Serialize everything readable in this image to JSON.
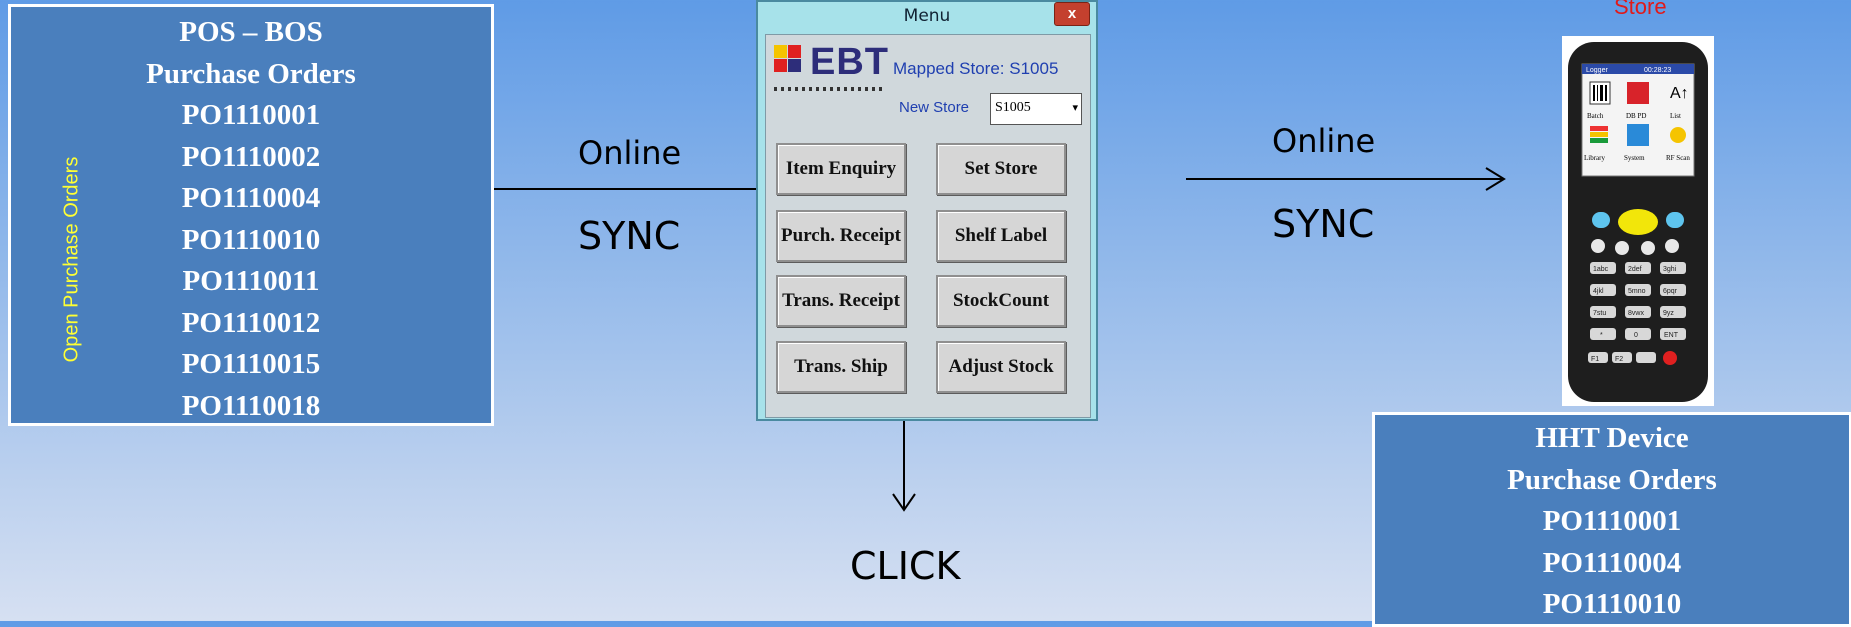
{
  "pos_box": {
    "lines": [
      "POS – BOS",
      "Purchase Orders",
      "PO1110001",
      "PO1110002",
      "PO1110004",
      "PO1110010",
      "PO1110011",
      "PO1110012",
      "PO1110015",
      "PO1110018"
    ]
  },
  "side_label": "Open Purchase Orders",
  "left_flow": {
    "online": "Online",
    "sync": "SYNC"
  },
  "right_flow": {
    "online": "Online",
    "sync": "SYNC"
  },
  "click_label": "CLICK",
  "menu": {
    "title": "Menu",
    "close": "x",
    "logo_text": "EBT",
    "mapped_store": "Mapped Store: S1005",
    "new_store_label": "New Store",
    "store_value": "S1005",
    "buttons": [
      "Item Enquiry",
      "Set Store",
      "Purch. Receipt",
      "Shelf Label",
      "Trans. Receipt",
      "StockCount",
      "Trans. Ship",
      "Adjust Stock"
    ]
  },
  "store_label": "Store",
  "hht_box": {
    "lines": [
      "HHT Device",
      "Purchase Orders",
      "PO1110001",
      "PO1110004",
      "PO1110010"
    ]
  },
  "device_screen": {
    "header": "Logger",
    "time": "00:28:23",
    "apps": [
      "Batch",
      "DB PD",
      "List",
      "Library",
      "System",
      "RF Scan"
    ],
    "keys": [
      "1abc",
      "2def",
      "3ghi",
      "4jkl",
      "5mno",
      "6pqr",
      "7stu",
      "8vwx",
      "9yz",
      "*",
      "0",
      "ENT",
      "F1",
      "F2"
    ]
  },
  "colors": {
    "box_fill": "#4a7fbd",
    "side_label": "#ffff33",
    "store_label": "#e01a1a",
    "menu_text": "#1f3fb0"
  }
}
